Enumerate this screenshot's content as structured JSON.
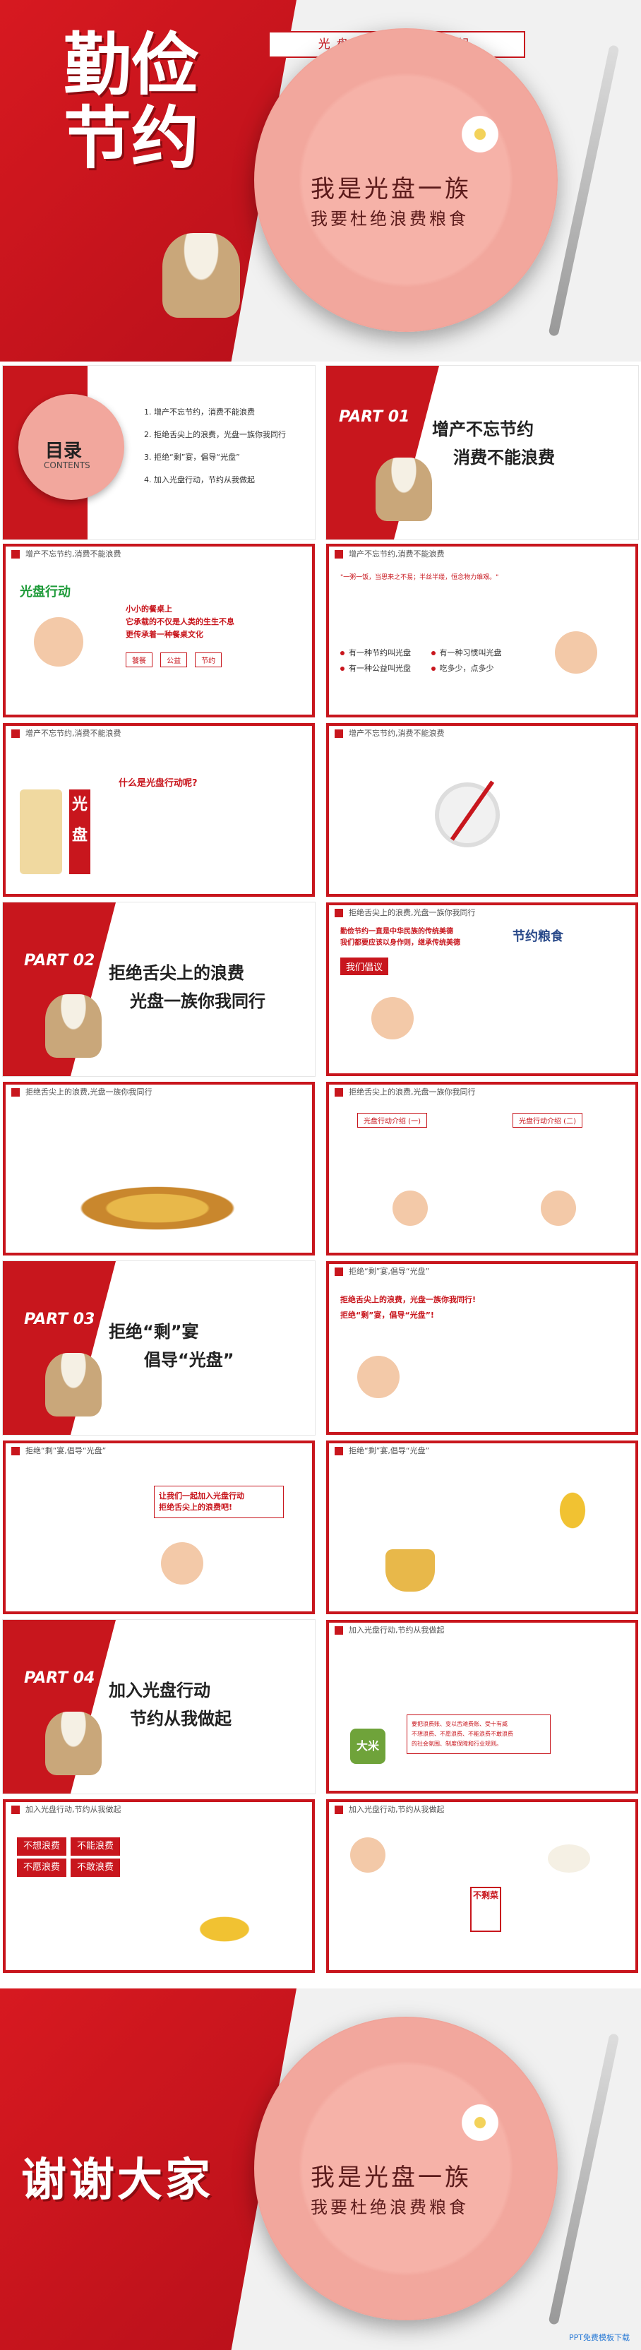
{
  "colors": {
    "brand": "#c8161d",
    "bg": "#ffffff",
    "plate": "#f2a79d"
  },
  "cover": {
    "title": "勤俭节约",
    "slogan": "光盘行动 从我做起",
    "plate_line1": "我是光盘一族",
    "plate_line2": "我要杜绝浪费粮食"
  },
  "toc": {
    "title": "目录",
    "subtitle": "CONTENTS",
    "items": [
      "1. 增产不忘节约，消费不能浪费",
      "2. 拒绝舌尖上的浪费，光盘一族你我同行",
      "3. 拒绝“剩”宴，倡导“光盘”",
      "4. 加入光盘行动，节约从我做起"
    ]
  },
  "part1": {
    "label": "PART 01",
    "title_line1": "增产不忘节约",
    "title_line2": "消费不能浪费"
  },
  "s3": {
    "header": "增产不忘节约,消费不能浪费",
    "logo": "光盘行动",
    "line1": "小小的餐桌上",
    "line2": "它承载的不仅是人类的生生不息",
    "line3": "更传承着一种餐桌文化",
    "tags": [
      "饕餮",
      "公益",
      "节约"
    ]
  },
  "s4": {
    "header": "增产不忘节约,消费不能浪费",
    "red_quote": "\"一粥一饭，当思来之不易；半丝半缕，恒念物力维艰。\"",
    "bullets": [
      "有一种节约叫光盘",
      "有一种习惯叫光盘",
      "有一种公益叫光盘",
      "吃多少，点多少"
    ]
  },
  "s5": {
    "header": "增产不忘节约,消费不能浪费",
    "question": "什么是光盘行动呢?",
    "badge1": "光",
    "badge2": "盘"
  },
  "s6": {
    "header": "增产不忘节约,消费不能浪费"
  },
  "part2": {
    "label": "PART 02",
    "title_line1": "拒绝舌尖上的浪费",
    "title_line2": "光盘一族你我同行"
  },
  "s8": {
    "header": "拒绝舌尖上的浪费,光盘一族你我同行",
    "red_title": "勤俭节约一直是中华民族的传统美德\n我们都要应该以身作则，继承传统美德",
    "tag": "我们倡议",
    "art": "节约粮食"
  },
  "s9": {
    "header": "拒绝舌尖上的浪费,光盘一族你我同行"
  },
  "s10": {
    "header": "拒绝舌尖上的浪费,光盘一族你我同行",
    "label1": "光盘行动介绍 (一)",
    "label2": "光盘行动介绍 (二)"
  },
  "part3": {
    "label": "PART 03",
    "title_line1": "拒绝“剩”宴",
    "title_line2": "倡导“光盘”"
  },
  "s12": {
    "header": "拒绝“剩”宴,倡导“光盘”",
    "red_title": "拒绝舌尖上的浪费，光盘一族你我同行!\n拒绝“剩”宴，倡导“光盘”!"
  },
  "s13": {
    "header": "拒绝“剩”宴,倡导“光盘”",
    "callout": "让我们一起加入光盘行动\n拒绝舌尖上的浪费吧!"
  },
  "s14": {
    "header": "拒绝“剩”宴,倡导“光盘”"
  },
  "part4": {
    "label": "PART 04",
    "title_line1": "加入光盘行动",
    "title_line2": "节约从我做起"
  },
  "s16": {
    "header": "加入光盘行动,节约从我做起",
    "rice": "大米",
    "box_text": "要把浪费账、变以舌滩费账、受十有威\n不想浪费、不愿浪费、不能浪费不敢浪费\n的社会氛围、制度保障和行业规则。"
  },
  "s17": {
    "header": "加入光盘行动,节约从我做起",
    "red_tags": [
      "不想浪费",
      "不能浪费",
      "不愿浪费",
      "不敢浪费"
    ]
  },
  "s18": {
    "header": "加入光盘行动,节约从我做起",
    "sign": "不剩菜"
  },
  "ending": {
    "title": "谢谢大家",
    "plate_line1": "我是光盘一族",
    "plate_line2": "我要杜绝浪费粮食",
    "watermark": "PPT免费模板下载"
  }
}
